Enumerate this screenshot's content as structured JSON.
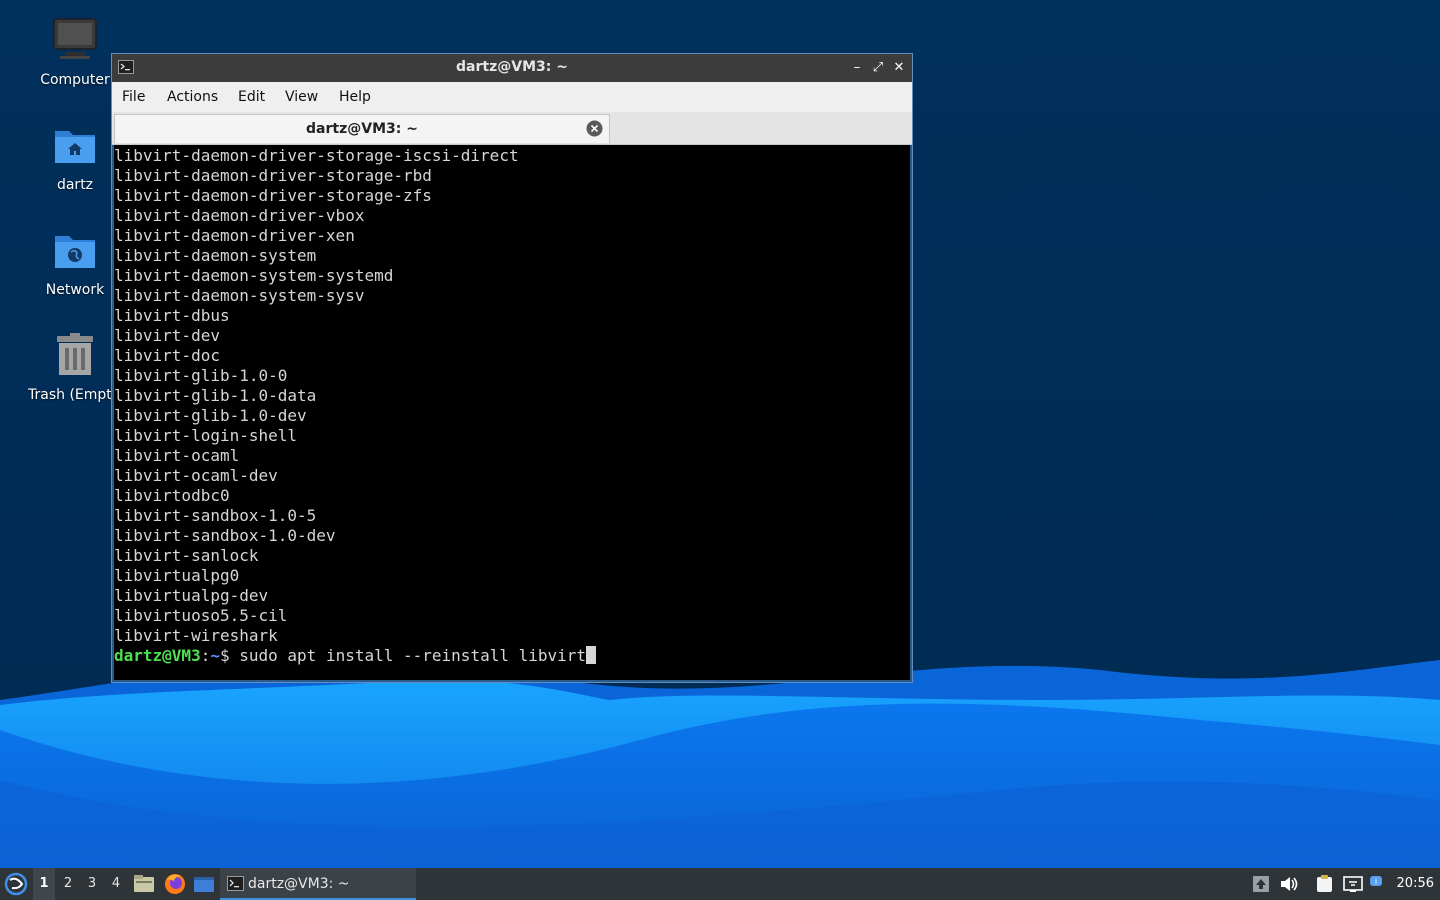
{
  "desktop": {
    "icons": [
      {
        "label": "Computer",
        "icon": "computer-icon"
      },
      {
        "label": "dartz",
        "icon": "home-folder-icon"
      },
      {
        "label": "Network",
        "icon": "network-folder-icon"
      },
      {
        "label": "Trash (Empty)",
        "icon": "trash-icon"
      }
    ]
  },
  "window": {
    "title": "dartz@VM3: ~",
    "buttons": {
      "minimize": "–",
      "maximize": "⤢",
      "close": "✕"
    },
    "menu": [
      "File",
      "Actions",
      "Edit",
      "View",
      "Help"
    ],
    "tab": {
      "label": "dartz@VM3: ~"
    }
  },
  "terminal": {
    "lines": [
      "libvirt-daemon-driver-storage-iscsi-direct",
      "libvirt-daemon-driver-storage-rbd",
      "libvirt-daemon-driver-storage-zfs",
      "libvirt-daemon-driver-vbox",
      "libvirt-daemon-driver-xen",
      "libvirt-daemon-system",
      "libvirt-daemon-system-systemd",
      "libvirt-daemon-system-sysv",
      "libvirt-dbus",
      "libvirt-dev",
      "libvirt-doc",
      "libvirt-glib-1.0-0",
      "libvirt-glib-1.0-data",
      "libvirt-glib-1.0-dev",
      "libvirt-login-shell",
      "libvirt-ocaml",
      "libvirt-ocaml-dev",
      "libvirtodbc0",
      "libvirt-sandbox-1.0-5",
      "libvirt-sandbox-1.0-dev",
      "libvirt-sanlock",
      "libvirtualpg0",
      "libvirtualpg-dev",
      "libvirtuoso5.5-cil",
      "libvirt-wireshark"
    ],
    "prompt": {
      "user": "dartz@VM3",
      "sep": ":",
      "path": "~",
      "symbol": "$ ",
      "command": "sudo apt install --reinstall libvirt"
    },
    "colors": {
      "background": "#000000",
      "text": "#d6d6d6",
      "user": "#4ee04e",
      "path": "#5c8cff"
    }
  },
  "taskbar": {
    "desktops": [
      "1",
      "2",
      "3",
      "4"
    ],
    "active_desktop": "1",
    "launchers": [
      "start-menu-icon",
      "file-manager-icon",
      "firefox-icon",
      "show-desktop-icon"
    ],
    "task": {
      "label": "dartz@VM3: ~"
    },
    "tray": [
      "updates-icon",
      "volume-icon",
      "clipboard-icon",
      "network-icon",
      "notification-icon"
    ],
    "clock": "20:56"
  }
}
